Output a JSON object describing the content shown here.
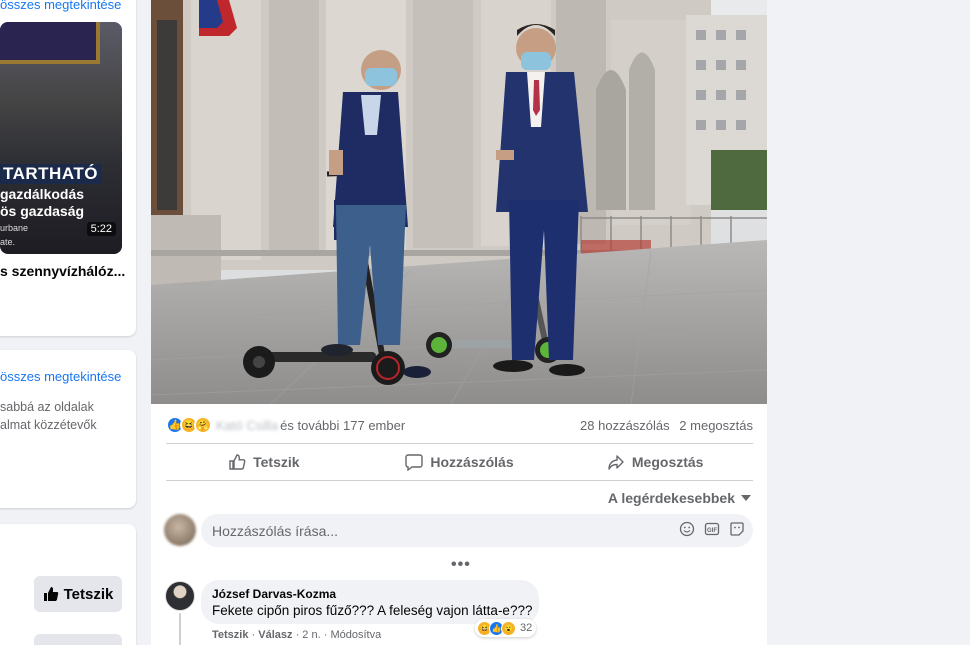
{
  "left": {
    "see_all_top": "összes megtekintése",
    "video": {
      "caption_main": "TARTHATÓ",
      "caption_line2": "gazdálkodás",
      "caption_line3": "ös gazdaság",
      "small_line1": "urbane",
      "small_line2": "ate.",
      "duration": "5:22",
      "title": "s szennyvízhálóz..."
    },
    "see_all": "összes megtekintése",
    "info_line1": "sabbá az oldalak",
    "info_line2": "almat közzétevők",
    "like_button": "Tetszik"
  },
  "post": {
    "reactions": {
      "icons": [
        "like-reaction",
        "haha-reaction",
        "care-reaction"
      ],
      "blurred_names": "Kató Csilla",
      "others_text": "és további 177 ember",
      "comments_count": "28 hozzászólás",
      "shares_count": "2 megosztás"
    },
    "actions": {
      "like": "Tetszik",
      "comment": "Hozzászólás",
      "share": "Megosztás"
    },
    "sort_label": "A legérdekesebbek",
    "comment_placeholder": "Hozzászólás írása...",
    "more": "•••",
    "comment": {
      "author": "József Darvas-Kozma",
      "text": "Fekete cipőn piros fűző??? A feleség vajon látta-e???",
      "reaction_count": "32",
      "like_link": "Tetszik",
      "reply_link": "Válasz",
      "age": "2 n.",
      "edited": "Módosítva"
    }
  },
  "colors": {
    "link": "#1877f2",
    "secondary_text": "#65676b",
    "like_blue": "#1877f2",
    "haha_yellow": "#f7b125"
  }
}
